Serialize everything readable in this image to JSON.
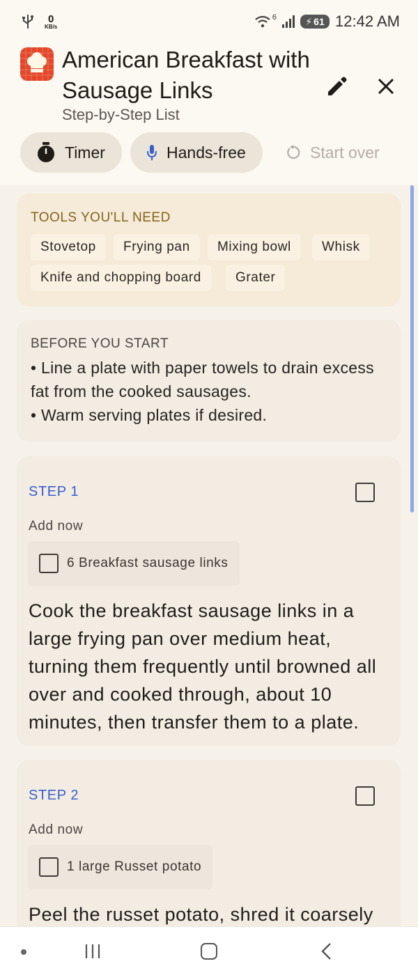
{
  "status": {
    "speed_value": "0",
    "speed_unit": "KB/s",
    "wifi_label": "6",
    "battery": "61",
    "time": "12:42 AM"
  },
  "header": {
    "title": "American Breakfast with Sausage Links",
    "subtitle": "Step-by-Step List",
    "timer_label": "Timer",
    "hands_free_label": "Hands-free",
    "start_over_label": "Start over"
  },
  "tools": {
    "title": "TOOLS YOU'LL NEED",
    "items": [
      "Stovetop",
      "Frying pan",
      "Mixing bowl",
      "Whisk",
      "Knife and chopping board",
      "Grater"
    ]
  },
  "before": {
    "title": "BEFORE YOU START",
    "lines": [
      "• Line a plate with paper towels to drain excess fat from the cooked sausages.",
      "• Warm serving plates if desired."
    ]
  },
  "steps": [
    {
      "label": "STEP 1",
      "add_now": "Add now",
      "ingredient": "6 Breakfast sausage links",
      "text": "Cook the breakfast sausage links in a large frying pan over medium heat, turning them frequently until browned all over and cooked through, about 10 minutes, then transfer them to a plate."
    },
    {
      "label": "STEP 2",
      "add_now": "Add now",
      "ingredient": "1 large Russet potato",
      "text": "Peel the russet potato, shred it coarsely"
    }
  ],
  "colors": {
    "accent": "#3a5fcb",
    "tools_title": "#83641d",
    "app_logo": "#e4462a"
  },
  "icons": {
    "timer": "stopwatch-icon",
    "hands_free": "microphone-icon",
    "start_over": "refresh-icon",
    "edit": "pencil-icon",
    "close": "close-icon"
  }
}
